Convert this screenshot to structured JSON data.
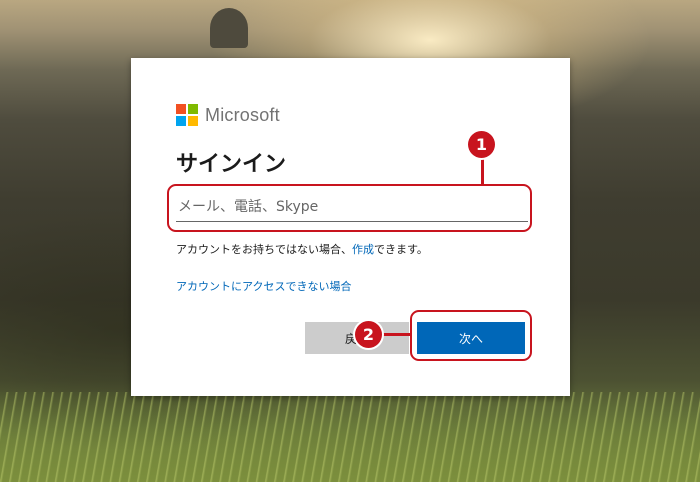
{
  "background": {
    "description_colors": [
      "#b9a781",
      "#3f3d30",
      "#85963f"
    ]
  },
  "logo": {
    "text": "Microsoft",
    "colors": [
      "#f25022",
      "#7fba00",
      "#00a4ef",
      "#ffb900"
    ]
  },
  "signin": {
    "title": "サインイン",
    "input_placeholder": "メール、電話、Skype",
    "input_value": "",
    "no_account_prefix": "アカウントをお持ちではない場合、",
    "no_account_link": "作成",
    "no_account_suffix": "できます。",
    "cant_access_link": "アカウントにアクセスできない場合",
    "back_label": "戻る",
    "next_label": "次へ"
  },
  "annotations": {
    "marker_1": "1",
    "marker_2": "2",
    "color": "#c8141e"
  },
  "colors": {
    "accent": "#0067b8",
    "secondary_button": "#cccccc"
  }
}
